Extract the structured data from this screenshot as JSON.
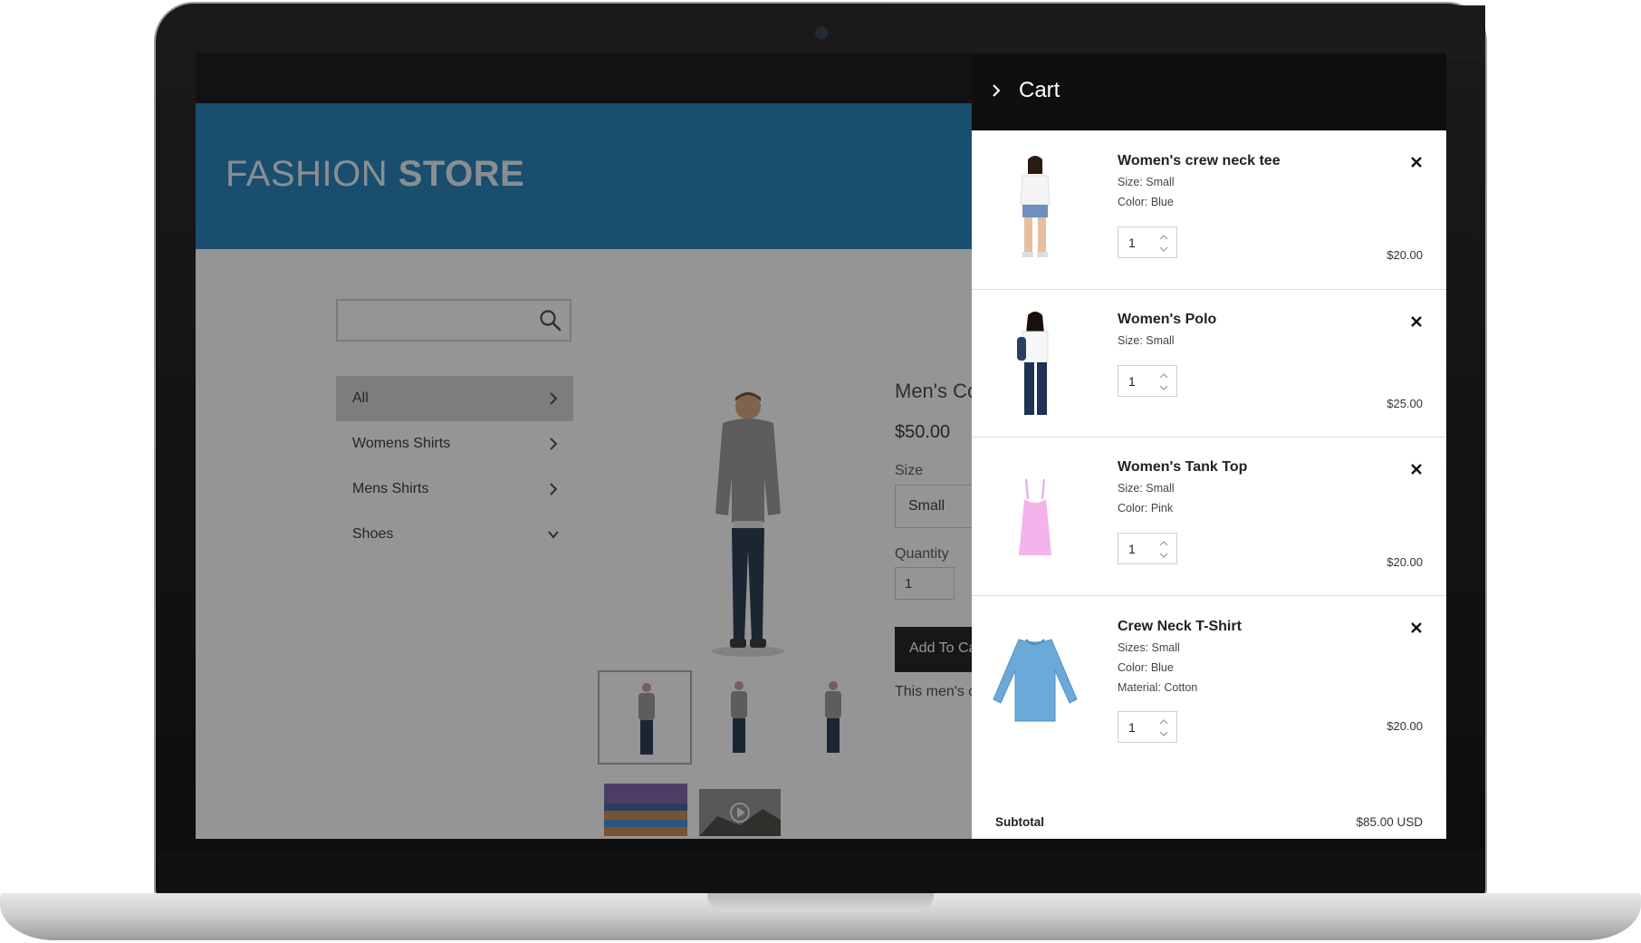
{
  "store": {
    "brand_light": "FASHION",
    "brand_bold": "STORE",
    "search": {
      "placeholder": ""
    },
    "categories": [
      {
        "label": "All",
        "active": true,
        "icon": "chevron-right-icon"
      },
      {
        "label": "Womens Shirts",
        "active": false,
        "icon": "chevron-right-icon"
      },
      {
        "label": "Mens Shirts",
        "active": false,
        "icon": "chevron-right-icon"
      },
      {
        "label": "Shoes",
        "active": false,
        "icon": "chevron-down-icon"
      }
    ],
    "product": {
      "title": "Men's Co",
      "price": "$50.00",
      "size_label": "Size",
      "size_value": "Small",
      "quantity_label": "Quantity",
      "quantity_value": "1",
      "add_to_cart": "Add To Ca",
      "description": "This men's c"
    }
  },
  "cart": {
    "title": "Cart",
    "items": [
      {
        "name": "Women's crew neck tee",
        "options": [
          "Size: Small",
          "Color: Blue"
        ],
        "quantity": "1",
        "price": "$20.00"
      },
      {
        "name": "Women's Polo",
        "options": [
          "Size: Small"
        ],
        "quantity": "1",
        "price": "$25.00"
      },
      {
        "name": "Women's Tank Top",
        "options": [
          "Size: Small",
          "Color: Pink"
        ],
        "quantity": "1",
        "price": "$20.00"
      },
      {
        "name": "Crew Neck T-Shirt",
        "options": [
          "Sizes: Small",
          "Color: Blue",
          "Material: Cotton"
        ],
        "quantity": "1",
        "price": "$20.00"
      }
    ],
    "subtotal_label": "Subtotal",
    "subtotal_value": "$85.00 USD"
  },
  "colors": {
    "header_blue": "#1e7fb8",
    "cart_header": "#0f0f0f",
    "overlay": "rgba(20,20,20,0.45)"
  }
}
